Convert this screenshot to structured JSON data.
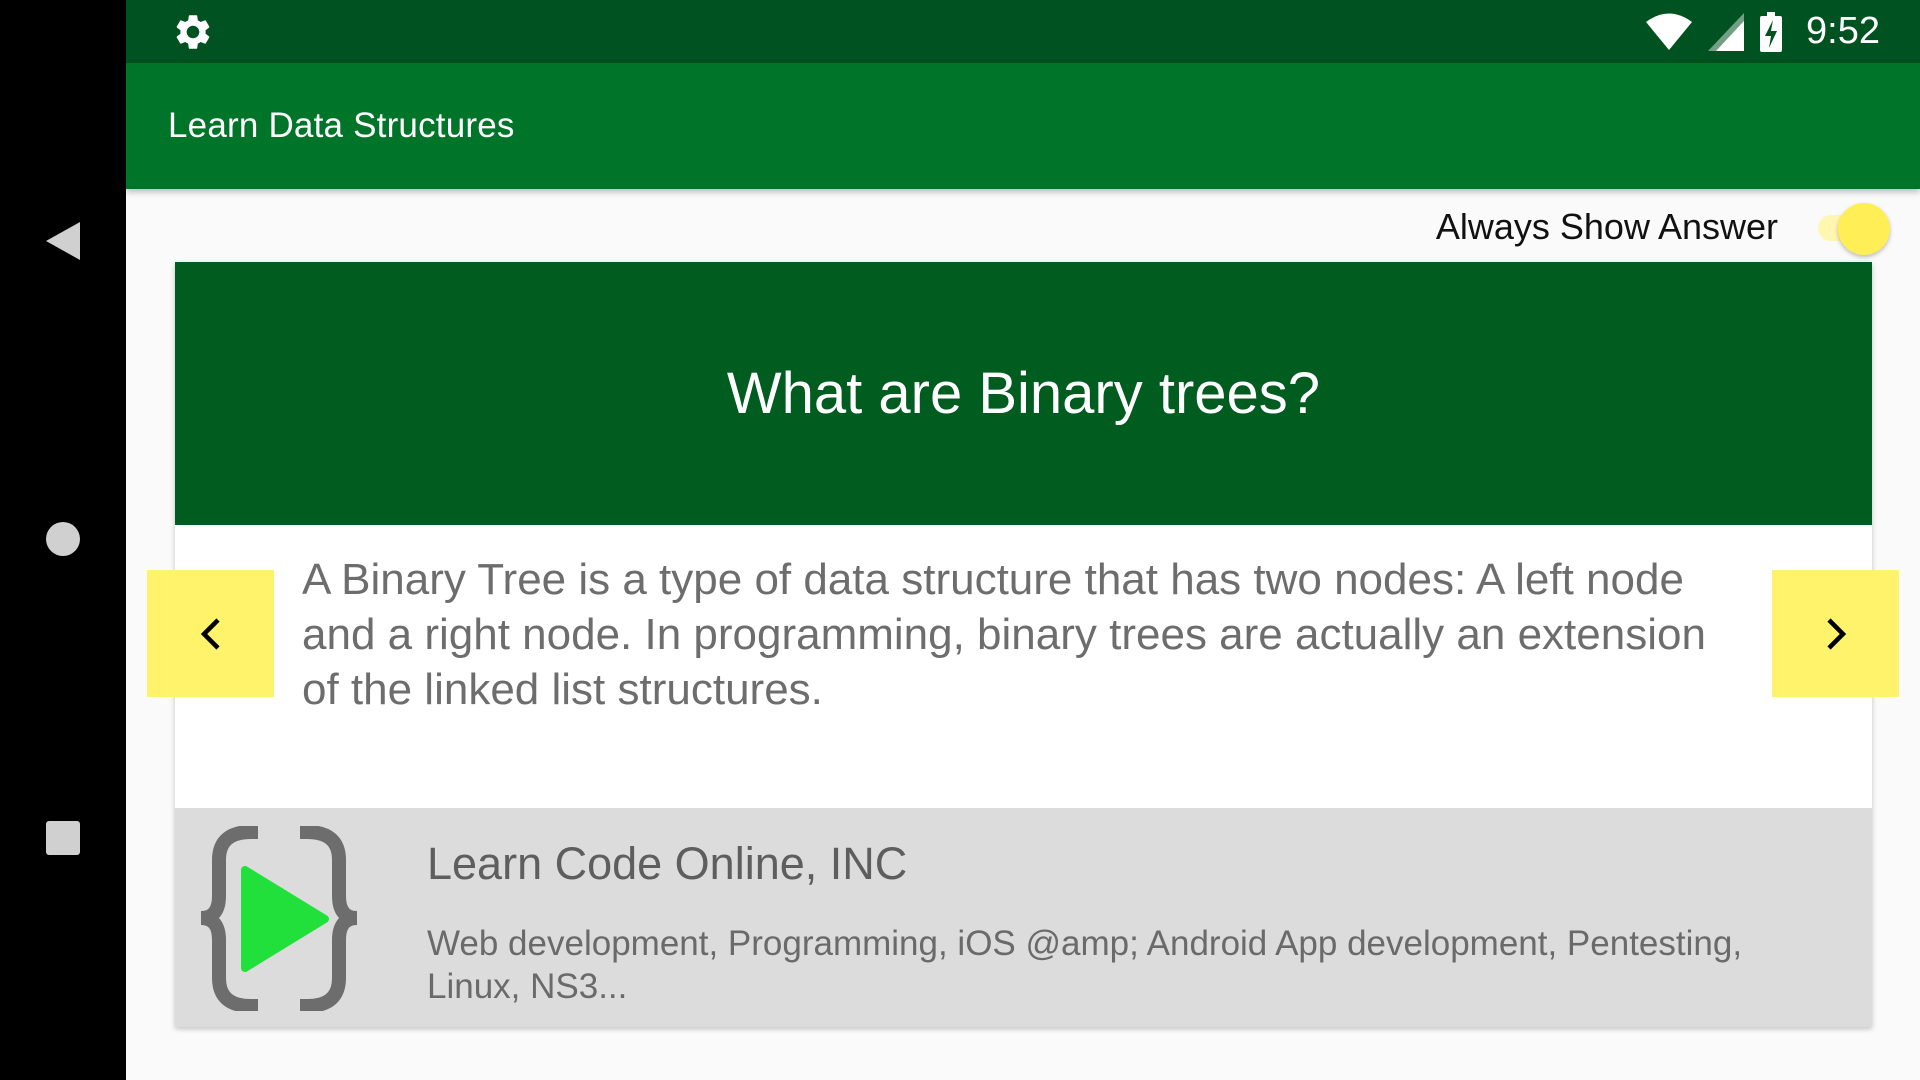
{
  "status_bar": {
    "time": "9:52",
    "icons": [
      "gear-icon",
      "wifi-icon",
      "cell-signal-icon",
      "battery-charging-icon"
    ]
  },
  "navigation": {
    "icons": [
      "back-triangle-icon",
      "home-circle-icon",
      "recents-square-icon"
    ]
  },
  "toolbar": {
    "title": "Learn Data Structures"
  },
  "settings": {
    "always_show_answer_label": "Always Show Answer",
    "always_show_answer_on": true
  },
  "flashcard": {
    "question": "What are Binary trees?",
    "answer": "A Binary Tree is a type of data structure that has two nodes: A left node and a right node. In programming, binary trees are actually an extension of the linked list structures.",
    "prev_icon": "chevron-left-icon",
    "next_icon": "chevron-right-icon"
  },
  "ad": {
    "title": "Learn Code Online, INC",
    "description": "Web development, Programming, iOS @amp; Android App development, Pentesting, Linux, NS3...",
    "logo_icon": "braces-play-logo-icon"
  },
  "colors": {
    "status_bar": "#005220",
    "toolbar": "#00752a",
    "question_bg": "#005c1f",
    "arrow_bg": "#fff36b",
    "switch_thumb": "#ffee55",
    "ad_bg": "#dcdcdc",
    "play_green": "#22e03c"
  }
}
